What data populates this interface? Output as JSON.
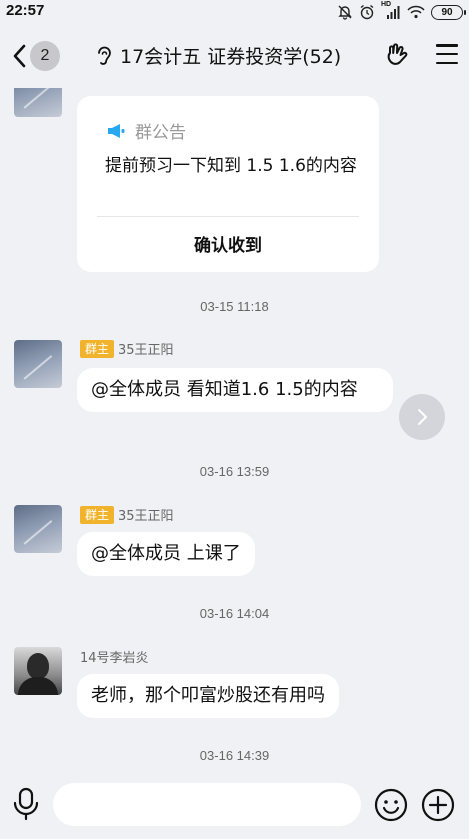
{
  "status_bar": {
    "time": "22:57",
    "hd_label": "HD",
    "battery": "90"
  },
  "header": {
    "unread_count": "2",
    "title": "17会计五 证券投资学(52)"
  },
  "announcement": {
    "label": "群公告",
    "text": "提前预习一下知到 1.5 1.6的内容",
    "confirm": "确认收到"
  },
  "messages": [
    {
      "timestamp": "03-15 11:18",
      "badge": "群主",
      "sender": "35王正阳",
      "text": "@全体成员 看知道1.6 1.5的内容"
    },
    {
      "timestamp": "03-16 13:59",
      "badge": "群主",
      "sender": "35王正阳",
      "text": "@全体成员 上课了"
    },
    {
      "timestamp": "03-16 14:04",
      "badge": "",
      "sender": "14号李岩炎",
      "text": "老师，那个叩富炒股还有用吗"
    }
  ],
  "last_timestamp": "03-16 14:39",
  "input": {
    "value": "",
    "placeholder": ""
  },
  "colors": {
    "background": "#f0f1f5",
    "bubble": "#ffffff",
    "role_badge": "#f1b32b",
    "announcement_icon": "#29a8f2"
  },
  "icons": [
    "back-icon",
    "ear-icon",
    "hand-icon",
    "menu-icon",
    "megaphone-icon",
    "chevron-right-icon",
    "mic-icon",
    "smile-icon",
    "plus-icon"
  ]
}
